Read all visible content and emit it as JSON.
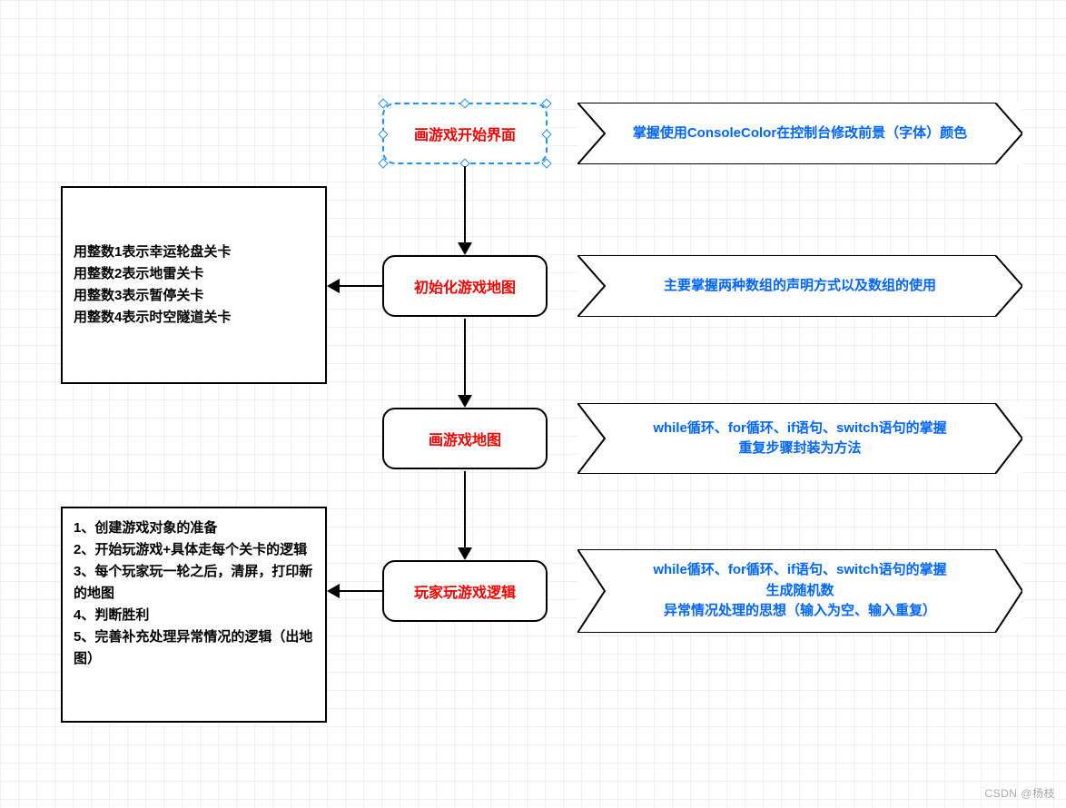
{
  "steps": {
    "step1": "画游戏开始界面",
    "step2": "初始化游戏地图",
    "step3": "画游戏地图",
    "step4": "玩家玩游戏逻辑"
  },
  "infos": {
    "info1": "掌握使用ConsoleColor在控制台修改前景（字体）颜色",
    "info2": "主要掌握两种数组的声明方式以及数组的使用",
    "info3_line1": "while循环、for循环、if语句、switch语句的掌握",
    "info3_line2": "重复步骤封装为方法",
    "info4_line1": "while循环、for循环、if语句、switch语句的掌握",
    "info4_line2": "生成随机数",
    "info4_line3": "异常情况处理的思想（输入为空、输入重复）"
  },
  "notes": {
    "note1_line1": "用整数1表示幸运轮盘关卡",
    "note1_line2": "用整数2表示地雷关卡",
    "note1_line3": "用整数3表示暂停关卡",
    "note1_line4": "用整数4表示时空隧道关卡",
    "note2_line1": "1、创建游戏对象的准备",
    "note2_line2": "2、开始玩游戏+具体走每个关卡的逻辑",
    "note2_line3": "3、每个玩家玩一轮之后，清屏，打印新的地图",
    "note2_line4": "4、判断胜利",
    "note2_line5": "5、完善补充处理异常情况的逻辑（出地图）"
  },
  "watermark": "CSDN @杨枝"
}
